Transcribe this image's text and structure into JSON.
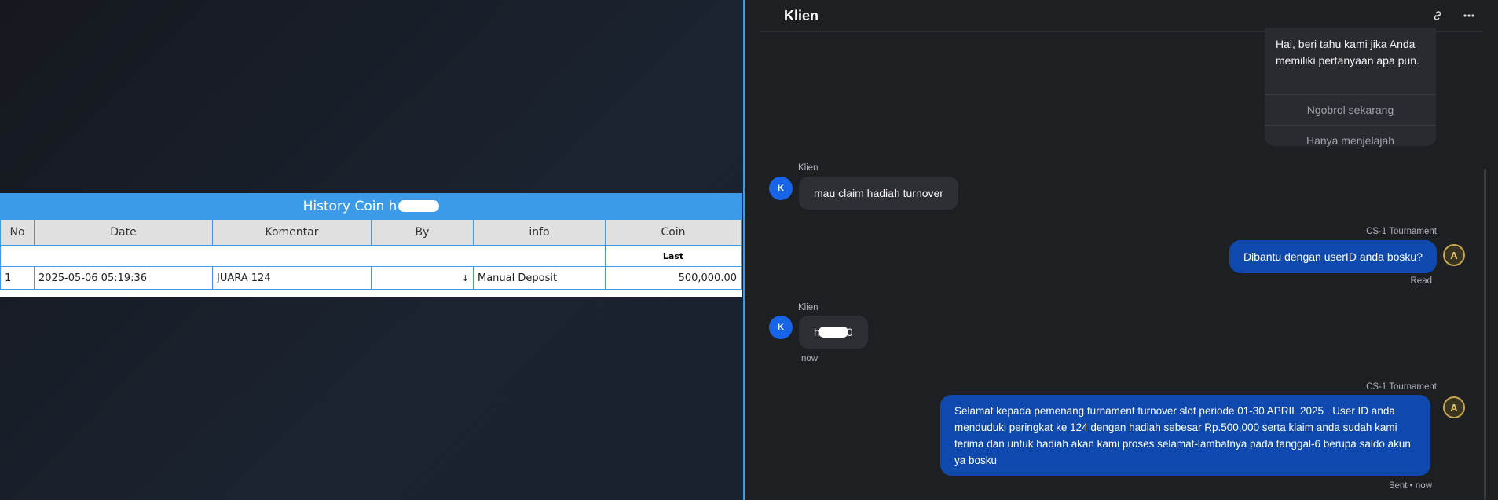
{
  "history": {
    "title_prefix": "History Coin h",
    "columns": [
      "No",
      "Date",
      "Komentar",
      "By",
      "info",
      "Coin"
    ],
    "sub_header": "Last",
    "rows": [
      {
        "no": "1",
        "date": "2025-05-06 05:19:36",
        "komentar": "JUARA 124",
        "by": "↓",
        "info": "Manual Deposit",
        "coin": "500,000.00"
      }
    ]
  },
  "chat": {
    "title": "Klien",
    "header_icons": [
      "link-icon",
      "more-icon"
    ],
    "welcome_card": {
      "text": "Hai, beri tahu kami jika Anda memiliki pertanyaan apa pun.",
      "buttons": [
        "Ngobrol sekarang",
        "Hanya menjelajah"
      ]
    },
    "messages": [
      {
        "from": "Klien",
        "avatar": "K",
        "text": "mau claim hadiah turnover"
      },
      {
        "from": "CS-1 Tournament",
        "avatar_icon": "agent-badge-icon",
        "text": "Dibantu dengan userID anda bosku?",
        "status": "Read"
      },
      {
        "from": "Klien",
        "avatar": "K",
        "text_prefix": "h",
        "text_suffix": "0",
        "time": "now"
      },
      {
        "from": "CS-1 Tournament",
        "avatar_icon": "agent-badge-icon",
        "text": "Selamat kepada pemenang turnament turnover slot periode 01-30 APRIL 2025 . User ID anda menduduki peringkat ke 124 dengan hadiah sebesar Rp.500,000 serta klaim anda sudah kami terima dan untuk hadiah akan kami proses selamat-lambatnya pada tanggal-6 berupa saldo akun ya bosku",
        "status": "Sent • now"
      }
    ]
  },
  "colors": {
    "accent": "#3c9be8",
    "bubble_out": "#0f49ad",
    "avatar": "#1764e8",
    "coin": "#1e8a1e"
  }
}
